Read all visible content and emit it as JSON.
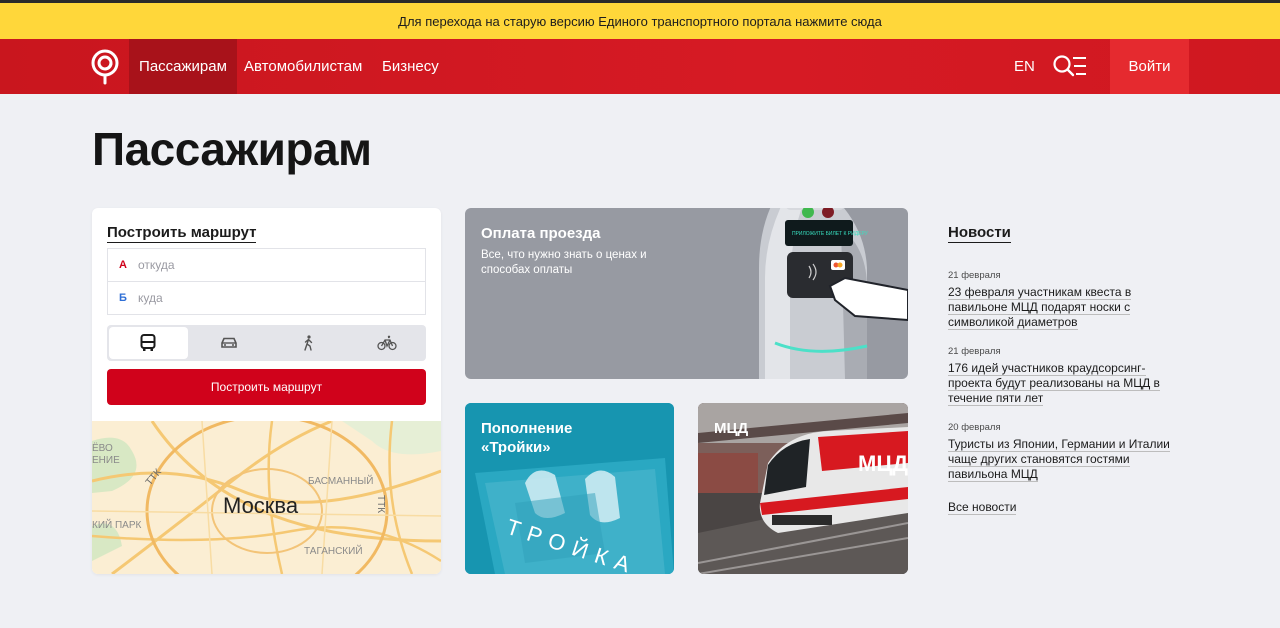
{
  "banner": {
    "text": "Для перехода на старую версию Единого транспортного портала нажмите сюда"
  },
  "header": {
    "nav": [
      "Пассажирам",
      "Автомобилистам",
      "Бизнесу"
    ],
    "lang": "EN",
    "login": "Войти"
  },
  "page": {
    "title": "Пассажирам"
  },
  "route": {
    "title": "Построить маршрут",
    "from_mark": "А",
    "from_placeholder": "откуда",
    "to_mark": "Б",
    "to_placeholder": "куда",
    "modes": [
      "bus-icon",
      "car-icon",
      "walk-icon",
      "bike-icon"
    ],
    "active_mode": "bus-icon",
    "button": "Построить маршрут"
  },
  "map": {
    "city": "Москва",
    "labels": [
      "ЁВО",
      "ЕНИЕ",
      "ТТК",
      "БАСМАННЫЙ",
      "ТТК",
      "КИЙ ПАРК",
      "ТАГАНСКИЙ"
    ]
  },
  "pay_card": {
    "title": "Оплата проезда",
    "subtitle": "Все, что нужно знать о ценах и способах оплаты",
    "screen_text": "ПРИЛОЖИТЕ БИЛЕТ К РИДЕРУ"
  },
  "troika_card": {
    "title": "Пополнение «Тройки»",
    "card_text": "ТРОЙКА"
  },
  "mcd_card": {
    "title": "МЦД",
    "train_text": "МЦД"
  },
  "news": {
    "title": "Новости",
    "items": [
      {
        "date": "21 февраля",
        "text": "23 февраля участникам квеста в павильоне МЦД подарят носки с символикой диаметров"
      },
      {
        "date": "21 февраля",
        "text": "176 идей участников краудсорсинг-проекта будут реализованы на МЦД в течение пяти лет"
      },
      {
        "date": "20 февраля",
        "text": "Туристы из Японии, Германии и Италии чаще других становятся гостями павильона МЦД"
      }
    ],
    "all": "Все новости"
  },
  "colors": {
    "brand_red": "#d61a24",
    "banner_yellow": "#ffd73a",
    "button_red": "#d0021b"
  }
}
